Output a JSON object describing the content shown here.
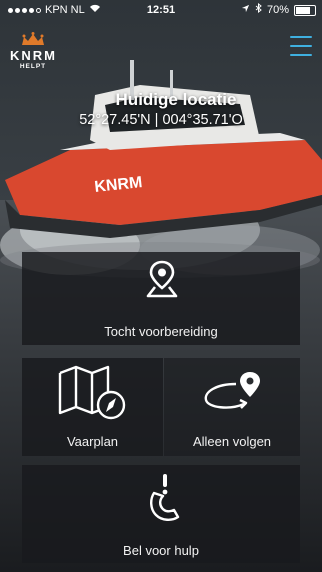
{
  "status_bar": {
    "carrier": "KPN NL",
    "time": "12:51",
    "battery": "70%",
    "battery_level": 0.7
  },
  "header": {
    "logo_text": "KNRM",
    "logo_subtext": "HELPT",
    "menu_icon": "hamburger-menu-icon",
    "accent_color": "#3fb0e0"
  },
  "location": {
    "title": "Huidige locatie",
    "coordinates": "52°27.45'N | 004°35.71'O"
  },
  "background": {
    "boat_marking": "KNRM",
    "boat_hull_color": "#d9482f"
  },
  "tiles": [
    {
      "label": "Tocht voorbereiding",
      "icon": "map-pin-icon"
    },
    {
      "label": "Vaarplan",
      "icon": "map-compass-icon"
    },
    {
      "label": "Alleen volgen",
      "icon": "route-pin-icon"
    },
    {
      "label": "Bel voor hulp",
      "icon": "phone-alert-icon"
    }
  ]
}
